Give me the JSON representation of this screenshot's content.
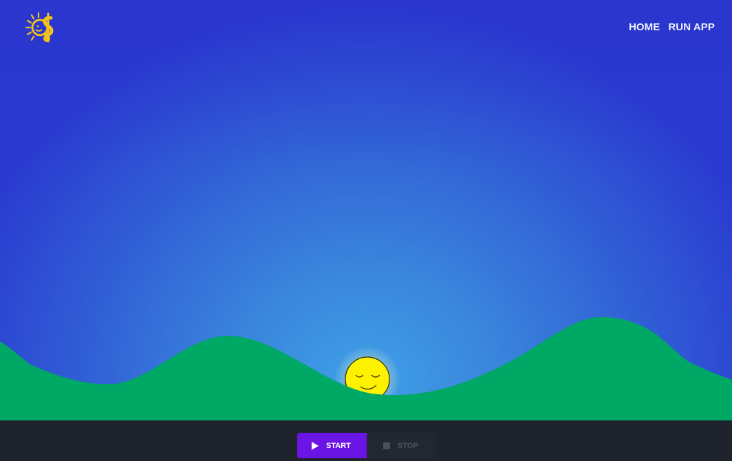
{
  "header": {
    "logo_icon": "sun-dollar-logo",
    "nav": [
      {
        "label": "HOME"
      },
      {
        "label": "RUN APP"
      }
    ]
  },
  "scene": {
    "sun_icon": "sleeping-sun-face",
    "hill_color": "#00a866",
    "sky_top": "#2a35cc",
    "sky_glow": "#3fa0e6",
    "sun_color": "#fff200"
  },
  "controls": {
    "start_label": "START",
    "start_icon": "play-icon",
    "stop_label": "STOP",
    "stop_icon": "stop-icon",
    "accent": "#6a14e6",
    "bar_color": "#1f232b"
  }
}
